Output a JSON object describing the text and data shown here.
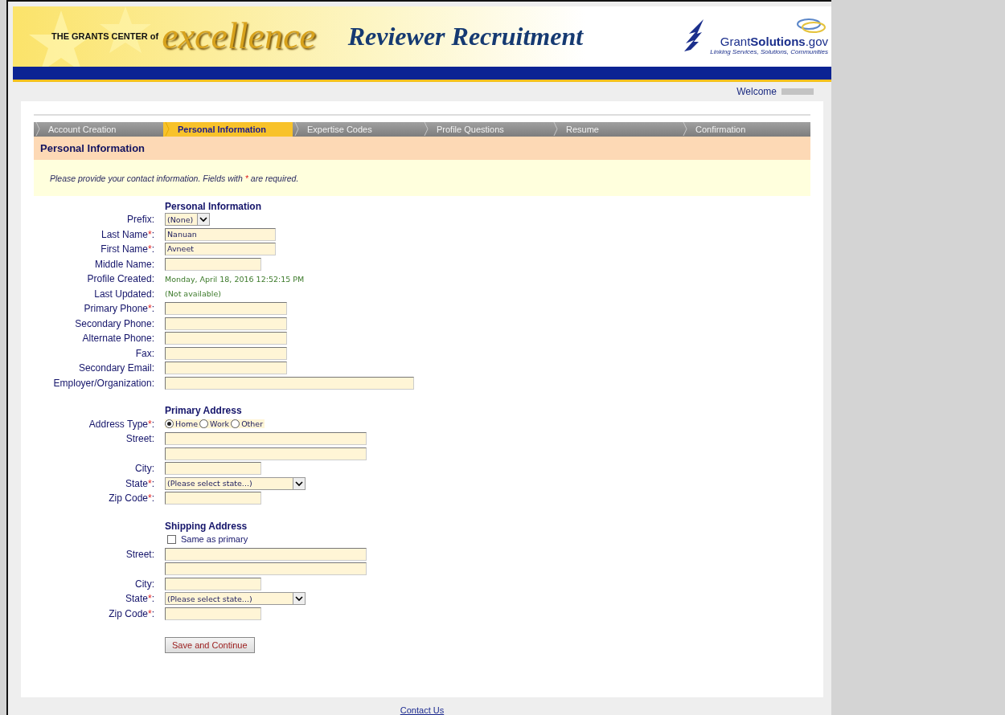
{
  "header": {
    "prefix": "THE GRANTS CENTER of",
    "brand": "excellence",
    "title": "Reviewer Recruitment",
    "logo_text": "Grant**Solutions**.gov",
    "logo_tagline": "Linking Services, Solutions, Communities"
  },
  "welcome": {
    "label": "Welcome"
  },
  "steps": [
    {
      "label": "Account Creation",
      "selected": false
    },
    {
      "label": "Personal Information",
      "selected": true
    },
    {
      "label": "Expertise Codes",
      "selected": false
    },
    {
      "label": "Profile Questions",
      "selected": false
    },
    {
      "label": "Resume",
      "selected": false
    },
    {
      "label": "Confirmation",
      "selected": false
    }
  ],
  "page_title": "Personal Information",
  "instruction": {
    "before": "Please provide your contact information. Fields with",
    "mark": "*",
    "after": "are required."
  },
  "sections": [
    {
      "heading": "Personal Information",
      "rows": [
        {
          "kind": "select",
          "label": "Prefix",
          "tail": ":",
          "value": "(None)"
        },
        {
          "kind": "name",
          "label": "Last Name",
          "req": "*",
          "tail": ":",
          "value": "Nanuan"
        },
        {
          "kind": "name",
          "label": "First Name",
          "req": "*",
          "tail": ":",
          "value": "Avneet"
        },
        {
          "kind": "short",
          "label": "Middle Name",
          "tail": ":"
        },
        {
          "kind": "info",
          "label": "Profile Created",
          "tail": ":",
          "value": "Monday, April 18, 2016 12:52:15 PM"
        },
        {
          "kind": "info",
          "label": "Last Updated",
          "tail": ":",
          "value": "(Not available)"
        },
        {
          "kind": "medium",
          "label": "Primary Phone",
          "req": "*",
          "tail": ":"
        },
        {
          "kind": "medium",
          "label": "Secondary Phone",
          "tail": ":"
        },
        {
          "kind": "medium",
          "label": "Alternate Phone",
          "tail": ":"
        },
        {
          "kind": "medium",
          "label": "Fax",
          "tail": ":"
        },
        {
          "kind": "medium",
          "label": "Secondary Email",
          "tail": ":"
        },
        {
          "kind": "long",
          "label": "Employer/Organization",
          "tail": ":"
        }
      ]
    },
    {
      "heading": "Primary Address",
      "rows": [
        {
          "kind": "radio",
          "label": "Address Type",
          "req": "*",
          "tail": ":",
          "options": [
            {
              "label": "Home",
              "selected": true
            },
            {
              "label": "Work",
              "selected": false
            },
            {
              "label": "Other",
              "selected": false
            }
          ]
        },
        {
          "kind": "street",
          "label": "Street",
          "tail": ":"
        },
        {
          "kind": "street"
        },
        {
          "kind": "short",
          "label": "City",
          "tail": ":"
        },
        {
          "kind": "state",
          "label": "State",
          "req": "*",
          "tail": ":",
          "value": "(Please select state...)"
        },
        {
          "kind": "short",
          "label": "Zip Code",
          "req": "*",
          "tail": ":"
        }
      ]
    },
    {
      "heading": "Shipping Address",
      "rows": [
        {
          "kind": "checkbox",
          "text": "Same as primary",
          "checked": false
        },
        {
          "kind": "street",
          "label": "Street",
          "tail": ":"
        },
        {
          "kind": "street"
        },
        {
          "kind": "short",
          "label": "City",
          "tail": ":"
        },
        {
          "kind": "state",
          "label": "State",
          "req": "*",
          "tail": ":",
          "value": "(Please select state...)"
        },
        {
          "kind": "short",
          "label": "Zip Code",
          "req": "*",
          "tail": ":"
        }
      ]
    }
  ],
  "save_button": "Save and Continue",
  "footer_link": "Contact Us"
}
